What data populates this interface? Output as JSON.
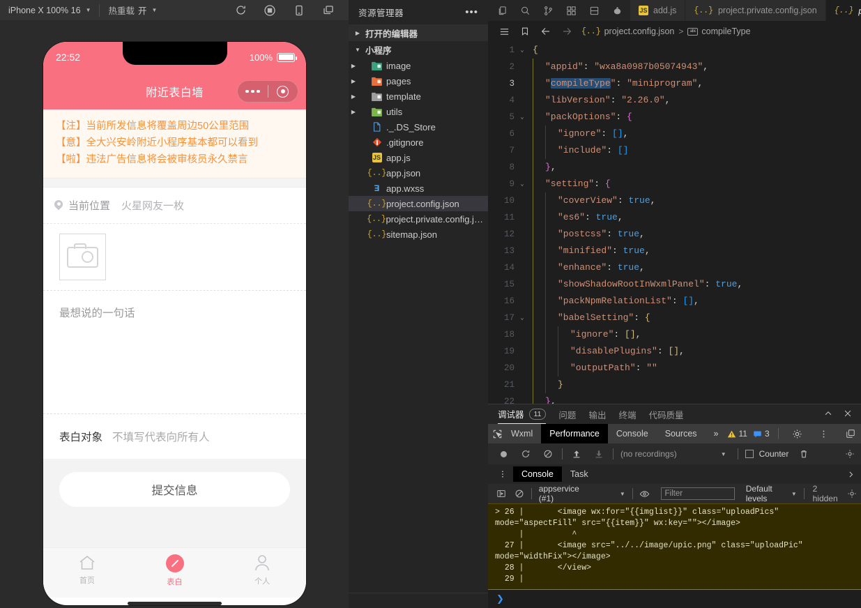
{
  "simulator": {
    "toolbar": {
      "device": "iPhone X 100% 16",
      "hotreload_label": "热重载",
      "hotreload_value": "开",
      "icons": [
        "refresh-icon",
        "record-icon",
        "device-icon",
        "window-icon"
      ]
    },
    "phone": {
      "time": "22:52",
      "battery": "100%",
      "nav_title": "附近表白墙",
      "notice": [
        "【注】当前所发信息将覆盖周边50公里范围",
        "【意】全大兴安岭附近小程序基本都可以看到",
        "【啦】违法广告信息将会被审核员永久禁言"
      ],
      "location_label": "当前位置",
      "location_value": "火星网友一枚",
      "message_placeholder": "最想说的一句话",
      "target_label": "表白对象",
      "target_hint": "不填写代表向所有人",
      "submit_label": "提交信息",
      "tabs": [
        {
          "label": "首页",
          "icon": "home-icon",
          "active": false
        },
        {
          "label": "表白",
          "icon": "compass-icon",
          "active": true
        },
        {
          "label": "个人",
          "icon": "person-icon",
          "active": false
        }
      ],
      "brand_color": "#f97181",
      "notice_bg": "#fff8f1",
      "notice_color": "#f5933f"
    }
  },
  "explorer": {
    "title": "资源管理器",
    "more_icon": "ellipsis-icon",
    "sections": [
      {
        "label": "打开的编辑器",
        "expanded": false
      },
      {
        "label": "小程序",
        "expanded": true
      }
    ],
    "items": [
      {
        "name": "image",
        "type": "folder",
        "depth": 1,
        "selected": false
      },
      {
        "name": "pages",
        "type": "folder",
        "depth": 1,
        "selected": false
      },
      {
        "name": "template",
        "type": "folder",
        "depth": 1,
        "selected": false
      },
      {
        "name": "utils",
        "type": "folder",
        "depth": 1,
        "selected": false
      },
      {
        "name": "._.DS_Store",
        "type": "file",
        "depth": 1,
        "selected": false
      },
      {
        "name": ".gitignore",
        "type": "git",
        "depth": 1,
        "selected": false
      },
      {
        "name": "app.js",
        "type": "js",
        "depth": 1,
        "selected": false
      },
      {
        "name": "app.json",
        "type": "json",
        "depth": 1,
        "selected": false
      },
      {
        "name": "app.wxss",
        "type": "wxss",
        "depth": 1,
        "selected": false
      },
      {
        "name": "project.config.json",
        "type": "json",
        "depth": 1,
        "selected": true
      },
      {
        "name": "project.private.config.js...",
        "type": "json",
        "depth": 1,
        "selected": false
      },
      {
        "name": "sitemap.json",
        "type": "json",
        "depth": 1,
        "selected": false
      }
    ]
  },
  "editor": {
    "activity_icons": [
      "copy-icon",
      "search-icon",
      "source-control-icon",
      "extensions-icon",
      "panel-icon",
      "debug-icon"
    ],
    "tabs": [
      {
        "label": "add.js",
        "type": "js",
        "active": false,
        "dirty": false
      },
      {
        "label": "project.private.config.json",
        "type": "json",
        "active": false,
        "dirty": false
      },
      {
        "label": "project.config.json",
        "type": "json",
        "active": true,
        "dirty": false
      }
    ],
    "tab_actions": [
      "split-editor-icon",
      "more-actions-icon"
    ],
    "breadcrumb_icons": [
      "outline-icon",
      "bookmark-icon",
      "back-arrow-icon",
      "forward-arrow-icon"
    ],
    "breadcrumb": [
      {
        "label": "project.config.json",
        "icon": "json-icon"
      },
      {
        "label": "compileType",
        "icon": "abc-icon"
      }
    ],
    "code_lines": [
      {
        "n": 1,
        "fold": "open",
        "indent": 0,
        "html": "<span class=\"br1\">{</span>"
      },
      {
        "n": 2,
        "fold": "",
        "indent": 1,
        "html": "<span class=\"s\">\"appid\"</span><span class=\"p\">: </span><span class=\"s\">\"wxa8a0987b05074943\"</span><span class=\"p\">,</span>"
      },
      {
        "n": 3,
        "fold": "",
        "indent": 1,
        "current": true,
        "html": "<span class=\"s\">\"<span class=\"hl\">compileType</span>\"</span><span class=\"p\">: </span><span class=\"s\">\"miniprogram\"</span><span class=\"p\">,</span>"
      },
      {
        "n": 4,
        "fold": "",
        "indent": 1,
        "html": "<span class=\"s\">\"libVersion\"</span><span class=\"p\">: </span><span class=\"s\">\"2.26.0\"</span><span class=\"p\">,</span>"
      },
      {
        "n": 5,
        "fold": "open",
        "indent": 1,
        "html": "<span class=\"s\">\"packOptions\"</span><span class=\"p\">: </span><span class=\"br2\">{</span>"
      },
      {
        "n": 6,
        "fold": "",
        "indent": 2,
        "html": "<span class=\"s\">\"ignore\"</span><span class=\"p\">: </span><span class=\"br3\">[]</span><span class=\"p\">,</span>"
      },
      {
        "n": 7,
        "fold": "",
        "indent": 2,
        "html": "<span class=\"s\">\"include\"</span><span class=\"p\">: </span><span class=\"br3\">[]</span>"
      },
      {
        "n": 8,
        "fold": "",
        "indent": 1,
        "html": "<span class=\"br2\">}</span><span class=\"p\">,</span>"
      },
      {
        "n": 9,
        "fold": "open",
        "indent": 1,
        "html": "<span class=\"s\">\"setting\"</span><span class=\"p\">: </span><span class=\"br2\">{</span>"
      },
      {
        "n": 10,
        "fold": "",
        "indent": 2,
        "html": "<span class=\"s\">\"coverView\"</span><span class=\"p\">: </span><span class=\"b\">true</span><span class=\"p\">,</span>"
      },
      {
        "n": 11,
        "fold": "",
        "indent": 2,
        "html": "<span class=\"s\">\"es6\"</span><span class=\"p\">: </span><span class=\"b\">true</span><span class=\"p\">,</span>"
      },
      {
        "n": 12,
        "fold": "",
        "indent": 2,
        "html": "<span class=\"s\">\"postcss\"</span><span class=\"p\">: </span><span class=\"b\">true</span><span class=\"p\">,</span>"
      },
      {
        "n": 13,
        "fold": "",
        "indent": 2,
        "html": "<span class=\"s\">\"minified\"</span><span class=\"p\">: </span><span class=\"b\">true</span><span class=\"p\">,</span>"
      },
      {
        "n": 14,
        "fold": "",
        "indent": 2,
        "html": "<span class=\"s\">\"enhance\"</span><span class=\"p\">: </span><span class=\"b\">true</span><span class=\"p\">,</span>"
      },
      {
        "n": 15,
        "fold": "",
        "indent": 2,
        "html": "<span class=\"s\">\"showShadowRootInWxmlPanel\"</span><span class=\"p\">: </span><span class=\"b\">true</span><span class=\"p\">,</span>"
      },
      {
        "n": 16,
        "fold": "",
        "indent": 2,
        "html": "<span class=\"s\">\"packNpmRelationList\"</span><span class=\"p\">: </span><span class=\"br3\">[]</span><span class=\"p\">,</span>"
      },
      {
        "n": 17,
        "fold": "open",
        "indent": 2,
        "html": "<span class=\"s\">\"babelSetting\"</span><span class=\"p\">: </span><span class=\"br1\">{</span>"
      },
      {
        "n": 18,
        "fold": "",
        "indent": 3,
        "html": "<span class=\"s\">\"ignore\"</span><span class=\"p\">: </span><span class=\"br1\">[]</span><span class=\"p\">,</span>"
      },
      {
        "n": 19,
        "fold": "",
        "indent": 3,
        "html": "<span class=\"s\">\"disablePlugins\"</span><span class=\"p\">: </span><span class=\"br1\">[]</span><span class=\"p\">,</span>"
      },
      {
        "n": 20,
        "fold": "",
        "indent": 3,
        "html": "<span class=\"s\">\"outputPath\"</span><span class=\"p\">: </span><span class=\"s\">\"\"</span>"
      },
      {
        "n": 21,
        "fold": "",
        "indent": 2,
        "html": "<span class=\"br1\">}</span>"
      },
      {
        "n": 22,
        "fold": "",
        "indent": 1,
        "html": "<span class=\"br2\">}</span><span class=\"p\">,</span>"
      }
    ]
  },
  "debugger": {
    "panel_tabs": [
      {
        "label": "调试器",
        "badge": "11",
        "active": true
      },
      {
        "label": "问题",
        "badge": "",
        "active": false
      },
      {
        "label": "输出",
        "badge": "",
        "active": false
      },
      {
        "label": "终端",
        "badge": "",
        "active": false
      },
      {
        "label": "代码质量",
        "badge": "",
        "active": false
      }
    ],
    "panel_actions": [
      "chevron-up-icon",
      "close-icon"
    ],
    "devtools_tabs": [
      {
        "label": "Wxml",
        "selected": false
      },
      {
        "label": "Performance",
        "selected": true
      },
      {
        "label": "Console",
        "selected": false
      },
      {
        "label": "Sources",
        "selected": false
      }
    ],
    "devtools_overflow": "»",
    "inspect_icon": "inspect-icon",
    "warnings": "11",
    "messages": "3",
    "devtools_right_icons": [
      "settings-icon",
      "more-vertical-icon",
      "dock-icon"
    ],
    "performance": {
      "icons": [
        "record-icon",
        "reload-icon",
        "clear-icon",
        "upload-icon",
        "download-icon"
      ],
      "recordings": "(no recordings)",
      "counter_label": "Counter",
      "trash_icon": "trash-icon",
      "settings_icon": "settings-icon"
    },
    "console": {
      "tabs": [
        {
          "label": "Console",
          "selected": true
        },
        {
          "label": "Task",
          "selected": false
        }
      ],
      "overflow_icon": "chevron-right-icon",
      "drawer_icon": "drawer-icon",
      "clear_icon": "clear-icon",
      "context": "appservice (#1)",
      "eye_icon": "eye-icon",
      "filter_placeholder": "Filter",
      "levels": "Default levels",
      "hidden": "2 hidden",
      "settings_icon": "settings-icon",
      "output": [
        "> 26 |       <image wx:for=\"{{imglist}}\" class=\"uploadPics\"",
        "mode=\"aspectFill\" src=\"{{item}}\" wx:key=\"\"></image>",
        "     |          ^",
        "  27 |       <image src=\"../../image/upic.png\" class=\"uploadPic\"",
        "mode=\"widthFix\"></image>",
        "  28 |       </view>",
        "  29 |"
      ],
      "prompt": "❯"
    }
  }
}
